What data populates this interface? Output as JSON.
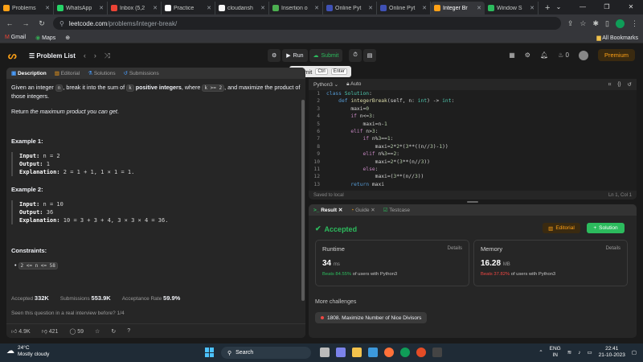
{
  "browser": {
    "tabs": [
      {
        "label": "Problems",
        "color": "#ffa116",
        "active": false
      },
      {
        "label": "WhatsApp",
        "color": "#25d366",
        "active": false
      },
      {
        "label": "Inbox (5,2",
        "color": "#ea4335",
        "active": false
      },
      {
        "label": "Practice",
        "color": "#ffffff",
        "active": false
      },
      {
        "label": "cloudansh",
        "color": "#f5f5f5",
        "active": false
      },
      {
        "label": "Insertion o",
        "color": "#4caf50",
        "active": false
      },
      {
        "label": "Online Pyt",
        "color": "#3f51b5",
        "active": false
      },
      {
        "label": "Online Pyt",
        "color": "#3f51b5",
        "active": false
      },
      {
        "label": "Integer Br",
        "color": "#ffa116",
        "active": true
      },
      {
        "label": "Window S",
        "color": "#2cbb5d",
        "active": false
      }
    ],
    "new_tab": "+",
    "url_host": "leetcode.com",
    "url_path": "/problems/integer-break/",
    "bookmarks": [
      {
        "label": "Gmail"
      },
      {
        "label": "Maps"
      }
    ],
    "all_bookmarks": "All Bookmarks"
  },
  "lc": {
    "problem_list": "Problem List",
    "run": "Run",
    "submit": "Submit",
    "streak": "0",
    "premium": "Premium",
    "tooltip": {
      "label": "Submit",
      "k1": "Ctrl",
      "k2": "Enter"
    }
  },
  "left": {
    "tabs": [
      "Description",
      "Editorial",
      "Solutions",
      "Submissions"
    ],
    "desc_p1_a": "Given an integer ",
    "desc_n": "n",
    "desc_p1_b": ", break it into the sum of ",
    "desc_k": "k",
    "desc_bold": "positive integers",
    "desc_p1_c": ", where ",
    "desc_kge": "k >= 2",
    "desc_p1_d": ", and maximize the product of those integers.",
    "desc_p2_a": "Return ",
    "desc_p2_em": "the maximum product you can get",
    "desc_p2_b": ".",
    "ex1_title": "Example 1:",
    "ex1_input_label": "Input:",
    "ex1_input": "n = 2",
    "ex1_output_label": "Output:",
    "ex1_output": "1",
    "ex1_expl_label": "Explanation:",
    "ex1_expl": "2 = 1 + 1, 1 × 1 = 1.",
    "ex2_title": "Example 2:",
    "ex2_input_label": "Input:",
    "ex2_input": "n = 10",
    "ex2_output_label": "Output:",
    "ex2_output": "36",
    "ex2_expl_label": "Explanation:",
    "ex2_expl": "10 = 3 + 3 + 4, 3 × 3 × 4 = 36.",
    "constraints_title": "Constraints:",
    "constraint1": "2 <= n <= 58",
    "accepted_label": "Accepted",
    "accepted_val": "332K",
    "subs_label": "Submissions",
    "subs_val": "553.9K",
    "rate_label": "Acceptance Rate",
    "rate_val": "59.9%",
    "seen": "Seen this question in a real interview before?   1/4",
    "likes": "4.9K",
    "dislikes": "421",
    "comments": "59"
  },
  "editor": {
    "lang": "Python3",
    "mode": "Auto",
    "saved": "Saved to local",
    "cursor": "Ln 1, Col 1",
    "lines": [
      "class Solution:",
      "    def integerBreak(self, n: int) -> int:",
      "        maxi=0",
      "        if n<=3:",
      "            maxi=n-1",
      "        elif n>3:",
      "            if n%3==1:",
      "                maxi=2*2*(3**((n//3)-1))",
      "            elif n%3==2:",
      "                maxi=2*(3**(n//3))",
      "            else:",
      "                maxi=(3**(n//3))",
      "        return maxi"
    ]
  },
  "result": {
    "tabs": [
      "Result",
      "Guide",
      "Testcase"
    ],
    "accepted": "Accepted",
    "editorial": "Editorial",
    "solution": "Solution",
    "runtime_title": "Runtime",
    "runtime_details": "Details",
    "runtime_val": "34",
    "runtime_unit": "ms",
    "runtime_beats": "Beats 84.55%",
    "runtime_beats_suffix": " of users with Python3",
    "memory_title": "Memory",
    "memory_details": "Details",
    "memory_val": "16.28",
    "memory_unit": "MB",
    "memory_beats": "Beats 37.82%",
    "memory_beats_suffix": " of users with Python3",
    "more": "More challenges",
    "chip": "1808. Maximize Number of Nice Divisors"
  },
  "taskbar": {
    "temp": "24°C",
    "weather": "Mostly cloudy",
    "search": "Search",
    "lang1": "ENG",
    "lang2": "IN",
    "time": "22:41",
    "date": "21-10-2023"
  }
}
